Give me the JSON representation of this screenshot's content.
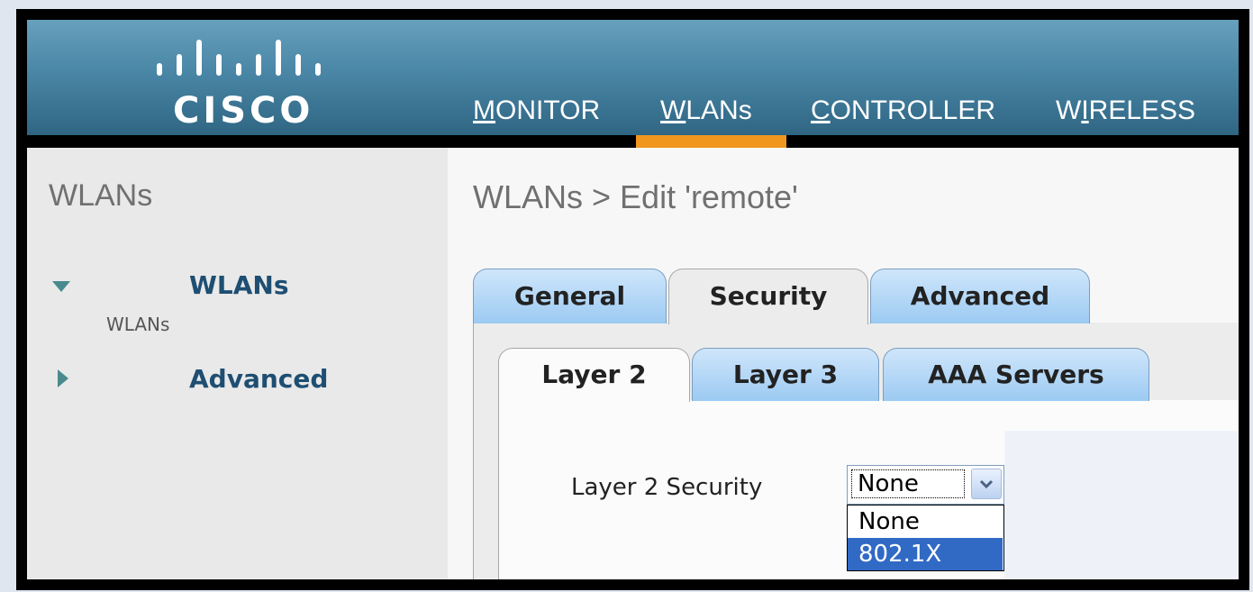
{
  "logo": {
    "text": "CISCO"
  },
  "nav": [
    {
      "label": "MONITOR",
      "accel": "M",
      "rest": "ONITOR"
    },
    {
      "label": "WLANs",
      "accel": "W",
      "rest": "LANs",
      "active": true
    },
    {
      "label": "CONTROLLER",
      "accel": "C",
      "rest": "ONTROLLER"
    },
    {
      "label": "WIRELESS",
      "pre": "W",
      "accel": "I",
      "rest": "RELESS"
    }
  ],
  "sidebar": {
    "title": "WLANs",
    "items": [
      {
        "label": "WLANs",
        "expanded": true,
        "sub": "WLANs"
      },
      {
        "label": "Advanced",
        "expanded": false
      }
    ]
  },
  "page_title": "WLANs > Edit  'remote'",
  "tabs": [
    "General",
    "Security",
    "Advanced"
  ],
  "active_tab": "Security",
  "subtabs": [
    "Layer 2",
    "Layer 3",
    "AAA Servers"
  ],
  "active_subtab": "Layer 2",
  "form": {
    "layer2_security_label": "Layer 2 Security",
    "selected": "None",
    "options": [
      "None",
      "802.1X"
    ],
    "highlighted_option": "802.1X"
  },
  "colors": {
    "accent": "#f0961e",
    "header": "#4a86a6",
    "tab_blue": "#9ccaf2",
    "highlight": "#316ac5"
  }
}
